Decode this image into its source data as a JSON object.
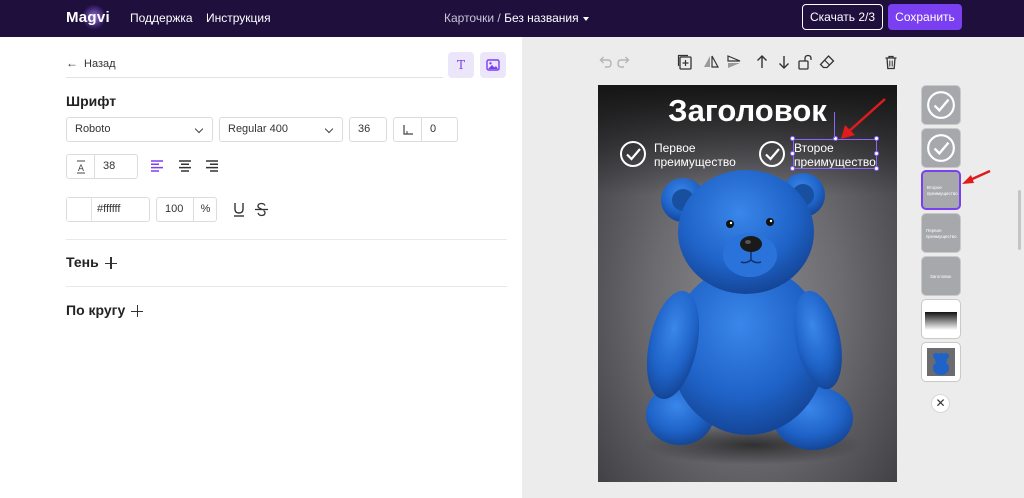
{
  "header": {
    "logo": "Magvi",
    "nav": [
      "Поддержка",
      "Инструкция"
    ],
    "breadcrumb_parent": "Карточки /",
    "breadcrumb_current": "Без названия",
    "download_label": "Скачать 2/3",
    "save_label": "Сохранить"
  },
  "editor": {
    "back_label": "Назад",
    "font_section": "Шрифт",
    "font_family": "Roboto",
    "font_weight": "Regular 400",
    "font_size": "36",
    "letter_spacing": "0",
    "line_height": "38",
    "color_hex": "#ffffff",
    "opacity": "100",
    "opacity_unit": "%",
    "shadow_label": "Тень",
    "circle_label": "По кругу"
  },
  "canvas": {
    "headline": "Заголовок",
    "feature_1": "Первое\nпреимущество",
    "feature_2": "Второе\nпреимущество",
    "background_color": "#6b6b70",
    "toy_color": "#1f63c8"
  },
  "layers": {
    "thumb_selected_text": "Второе преимущество",
    "thumb_4_text": "Первое преимущество",
    "thumb_5_text": "Заголовок"
  },
  "colors": {
    "accent": "#7b3ff2",
    "topbar": "#1e0f3d",
    "annotation_arrow": "#e01b1b"
  }
}
